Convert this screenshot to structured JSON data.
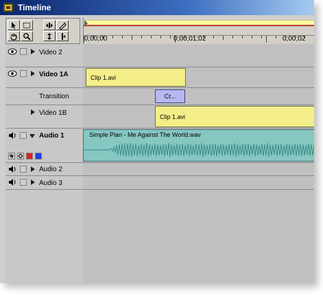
{
  "window": {
    "title": "Timeline"
  },
  "toolbox": {
    "tools": [
      "selection-tool",
      "range-select-tool",
      "track-select-tool",
      "razor-tool",
      "hand-tool",
      "zoom-tool",
      "ripple-edit-tool",
      "in-point-tool"
    ]
  },
  "ruler": {
    "timecodes": [
      "0;00;00",
      "0;00;01;02",
      "0;00;02"
    ]
  },
  "tracks": {
    "video2": {
      "label": "Video 2"
    },
    "video1a": {
      "label": "Video 1A",
      "clip": "Clip 1.avi"
    },
    "transition": {
      "label": "Transition",
      "clip": "Cr..."
    },
    "video1b": {
      "label": "Video 1B",
      "clip": "Clip 1.avi"
    },
    "audio1": {
      "label": "Audio 1",
      "clip": "Simple Plan - Me Against The World.wav"
    },
    "audio2": {
      "label": "Audio 2"
    },
    "audio3": {
      "label": "Audio 3"
    }
  },
  "colors": {
    "video_clip": "#f4ee8a",
    "audio_clip": "#86c7c2",
    "transition": "#b8b8f0",
    "title_bar": "#0a246a"
  }
}
